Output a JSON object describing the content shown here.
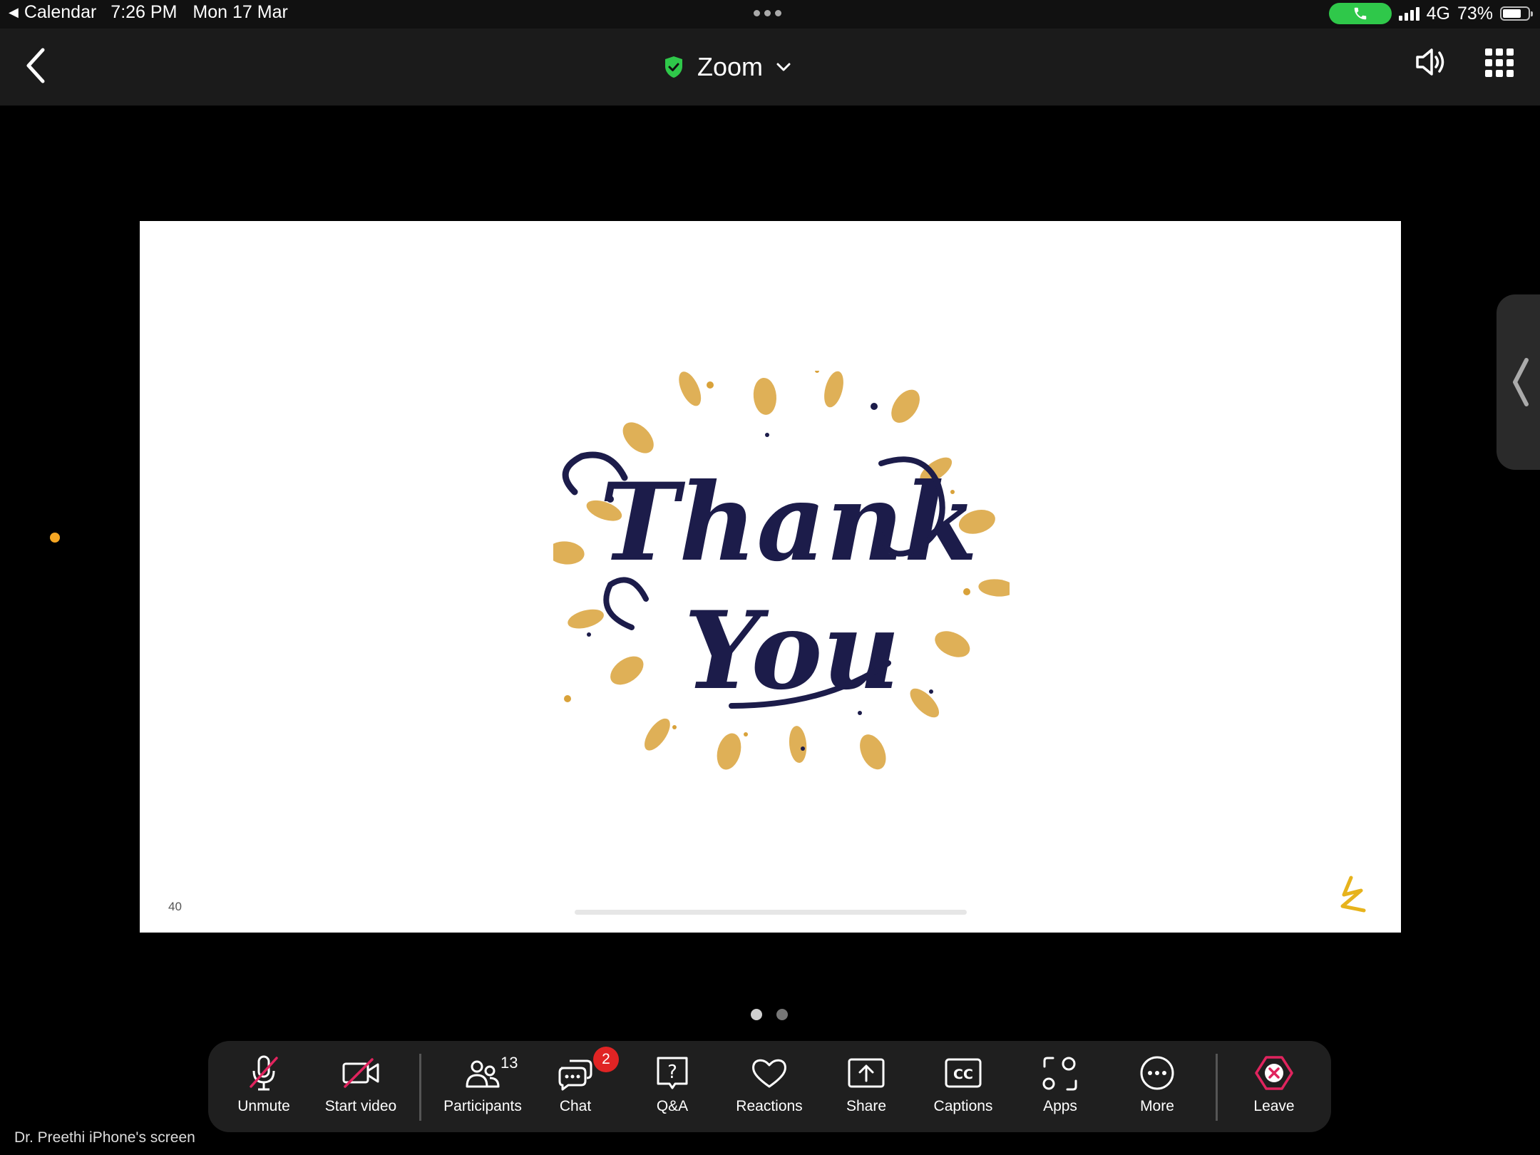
{
  "status_bar": {
    "back_app": "Calendar",
    "time": "7:26 PM",
    "date": "Mon 17 Mar",
    "network": "4G",
    "battery": "73%",
    "battery_level": 0.73,
    "call_color": "#2fc84a"
  },
  "nav": {
    "title": "Zoom",
    "secure_color": "#2fc84a"
  },
  "slide": {
    "page_number": "40",
    "headline": [
      "Thank",
      "You"
    ],
    "script_color": "#1c1c4a",
    "accent_color": "#d9a23a"
  },
  "pager": {
    "count": 2,
    "active_index": 0
  },
  "toolbar": {
    "unmute": "Unmute",
    "start_video": "Start video",
    "participants": "Participants",
    "participants_count": "13",
    "chat": "Chat",
    "chat_badge": "2",
    "qa": "Q&A",
    "reactions": "Reactions",
    "share": "Share",
    "captions": "Captions",
    "apps": "Apps",
    "more": "More",
    "leave": "Leave",
    "muted_color": "#e0245e",
    "leave_color": "#e0245e"
  },
  "screen_label": "Dr. Preethi iPhone's screen"
}
